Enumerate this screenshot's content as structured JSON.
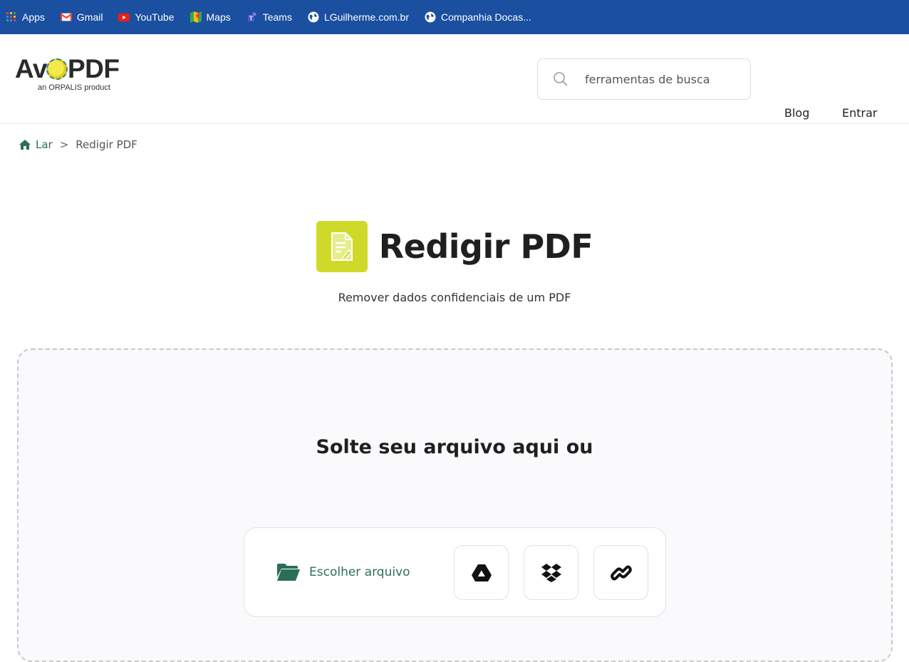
{
  "bookmarks": [
    {
      "label": "Apps",
      "icon": "apps-grid-icon"
    },
    {
      "label": "Gmail",
      "icon": "gmail-icon"
    },
    {
      "label": "YouTube",
      "icon": "youtube-icon"
    },
    {
      "label": "Maps",
      "icon": "maps-icon"
    },
    {
      "label": "Teams",
      "icon": "teams-icon"
    },
    {
      "label": "LGuilherme.com.br",
      "icon": "globe-icon"
    },
    {
      "label": "Companhia Docas...",
      "icon": "globe-icon"
    }
  ],
  "header": {
    "logo_text": "AvePDF",
    "logo_sub": "an ORPALIS product",
    "search_placeholder": "ferramentas de busca",
    "nav": {
      "blog": "Blog",
      "login": "Entrar"
    }
  },
  "breadcrumb": {
    "home": "Lar",
    "separator": ">",
    "current": "Redigir PDF"
  },
  "tool": {
    "title": "Redigir PDF",
    "subtitle": "Remover dados confidenciais de um PDF",
    "icon_color": "#cfd92a"
  },
  "upload": {
    "drop_title": "Solte seu arquivo aqui ou",
    "choose_label": "Escolher arquivo",
    "sources": [
      "google-drive-icon",
      "dropbox-icon",
      "link-icon"
    ]
  },
  "colors": {
    "bookmark_bar": "#1b4fa0",
    "accent": "#2c6e5a"
  }
}
